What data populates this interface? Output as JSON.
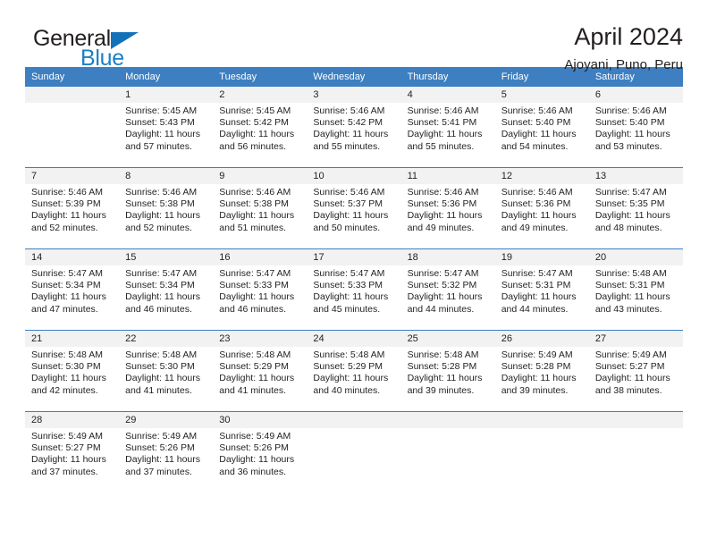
{
  "brand": {
    "name_top": "General",
    "name_bottom": "Blue",
    "flag_color": "#1271b8",
    "blue_color": "#1b7fc4"
  },
  "header": {
    "title": "April 2024",
    "subtitle": "Ajoyani, Puno, Peru"
  },
  "calendar": {
    "header_color": "#3d7fc1",
    "numberband_color": "#f2f2f2",
    "weekdays": [
      "Sunday",
      "Monday",
      "Tuesday",
      "Wednesday",
      "Thursday",
      "Friday",
      "Saturday"
    ],
    "weeks": [
      [
        {
          "day": "",
          "sunrise": "",
          "sunset": "",
          "daylight": ""
        },
        {
          "day": "1",
          "sunrise": "Sunrise: 5:45 AM",
          "sunset": "Sunset: 5:43 PM",
          "daylight": "Daylight: 11 hours and 57 minutes."
        },
        {
          "day": "2",
          "sunrise": "Sunrise: 5:45 AM",
          "sunset": "Sunset: 5:42 PM",
          "daylight": "Daylight: 11 hours and 56 minutes."
        },
        {
          "day": "3",
          "sunrise": "Sunrise: 5:46 AM",
          "sunset": "Sunset: 5:42 PM",
          "daylight": "Daylight: 11 hours and 55 minutes."
        },
        {
          "day": "4",
          "sunrise": "Sunrise: 5:46 AM",
          "sunset": "Sunset: 5:41 PM",
          "daylight": "Daylight: 11 hours and 55 minutes."
        },
        {
          "day": "5",
          "sunrise": "Sunrise: 5:46 AM",
          "sunset": "Sunset: 5:40 PM",
          "daylight": "Daylight: 11 hours and 54 minutes."
        },
        {
          "day": "6",
          "sunrise": "Sunrise: 5:46 AM",
          "sunset": "Sunset: 5:40 PM",
          "daylight": "Daylight: 11 hours and 53 minutes."
        }
      ],
      [
        {
          "day": "7",
          "sunrise": "Sunrise: 5:46 AM",
          "sunset": "Sunset: 5:39 PM",
          "daylight": "Daylight: 11 hours and 52 minutes."
        },
        {
          "day": "8",
          "sunrise": "Sunrise: 5:46 AM",
          "sunset": "Sunset: 5:38 PM",
          "daylight": "Daylight: 11 hours and 52 minutes."
        },
        {
          "day": "9",
          "sunrise": "Sunrise: 5:46 AM",
          "sunset": "Sunset: 5:38 PM",
          "daylight": "Daylight: 11 hours and 51 minutes."
        },
        {
          "day": "10",
          "sunrise": "Sunrise: 5:46 AM",
          "sunset": "Sunset: 5:37 PM",
          "daylight": "Daylight: 11 hours and 50 minutes."
        },
        {
          "day": "11",
          "sunrise": "Sunrise: 5:46 AM",
          "sunset": "Sunset: 5:36 PM",
          "daylight": "Daylight: 11 hours and 49 minutes."
        },
        {
          "day": "12",
          "sunrise": "Sunrise: 5:46 AM",
          "sunset": "Sunset: 5:36 PM",
          "daylight": "Daylight: 11 hours and 49 minutes."
        },
        {
          "day": "13",
          "sunrise": "Sunrise: 5:47 AM",
          "sunset": "Sunset: 5:35 PM",
          "daylight": "Daylight: 11 hours and 48 minutes."
        }
      ],
      [
        {
          "day": "14",
          "sunrise": "Sunrise: 5:47 AM",
          "sunset": "Sunset: 5:34 PM",
          "daylight": "Daylight: 11 hours and 47 minutes."
        },
        {
          "day": "15",
          "sunrise": "Sunrise: 5:47 AM",
          "sunset": "Sunset: 5:34 PM",
          "daylight": "Daylight: 11 hours and 46 minutes."
        },
        {
          "day": "16",
          "sunrise": "Sunrise: 5:47 AM",
          "sunset": "Sunset: 5:33 PM",
          "daylight": "Daylight: 11 hours and 46 minutes."
        },
        {
          "day": "17",
          "sunrise": "Sunrise: 5:47 AM",
          "sunset": "Sunset: 5:33 PM",
          "daylight": "Daylight: 11 hours and 45 minutes."
        },
        {
          "day": "18",
          "sunrise": "Sunrise: 5:47 AM",
          "sunset": "Sunset: 5:32 PM",
          "daylight": "Daylight: 11 hours and 44 minutes."
        },
        {
          "day": "19",
          "sunrise": "Sunrise: 5:47 AM",
          "sunset": "Sunset: 5:31 PM",
          "daylight": "Daylight: 11 hours and 44 minutes."
        },
        {
          "day": "20",
          "sunrise": "Sunrise: 5:48 AM",
          "sunset": "Sunset: 5:31 PM",
          "daylight": "Daylight: 11 hours and 43 minutes."
        }
      ],
      [
        {
          "day": "21",
          "sunrise": "Sunrise: 5:48 AM",
          "sunset": "Sunset: 5:30 PM",
          "daylight": "Daylight: 11 hours and 42 minutes."
        },
        {
          "day": "22",
          "sunrise": "Sunrise: 5:48 AM",
          "sunset": "Sunset: 5:30 PM",
          "daylight": "Daylight: 11 hours and 41 minutes."
        },
        {
          "day": "23",
          "sunrise": "Sunrise: 5:48 AM",
          "sunset": "Sunset: 5:29 PM",
          "daylight": "Daylight: 11 hours and 41 minutes."
        },
        {
          "day": "24",
          "sunrise": "Sunrise: 5:48 AM",
          "sunset": "Sunset: 5:29 PM",
          "daylight": "Daylight: 11 hours and 40 minutes."
        },
        {
          "day": "25",
          "sunrise": "Sunrise: 5:48 AM",
          "sunset": "Sunset: 5:28 PM",
          "daylight": "Daylight: 11 hours and 39 minutes."
        },
        {
          "day": "26",
          "sunrise": "Sunrise: 5:49 AM",
          "sunset": "Sunset: 5:28 PM",
          "daylight": "Daylight: 11 hours and 39 minutes."
        },
        {
          "day": "27",
          "sunrise": "Sunrise: 5:49 AM",
          "sunset": "Sunset: 5:27 PM",
          "daylight": "Daylight: 11 hours and 38 minutes."
        }
      ],
      [
        {
          "day": "28",
          "sunrise": "Sunrise: 5:49 AM",
          "sunset": "Sunset: 5:27 PM",
          "daylight": "Daylight: 11 hours and 37 minutes."
        },
        {
          "day": "29",
          "sunrise": "Sunrise: 5:49 AM",
          "sunset": "Sunset: 5:26 PM",
          "daylight": "Daylight: 11 hours and 37 minutes."
        },
        {
          "day": "30",
          "sunrise": "Sunrise: 5:49 AM",
          "sunset": "Sunset: 5:26 PM",
          "daylight": "Daylight: 11 hours and 36 minutes."
        },
        {
          "day": "",
          "sunrise": "",
          "sunset": "",
          "daylight": ""
        },
        {
          "day": "",
          "sunrise": "",
          "sunset": "",
          "daylight": ""
        },
        {
          "day": "",
          "sunrise": "",
          "sunset": "",
          "daylight": ""
        },
        {
          "day": "",
          "sunrise": "",
          "sunset": "",
          "daylight": ""
        }
      ]
    ]
  }
}
